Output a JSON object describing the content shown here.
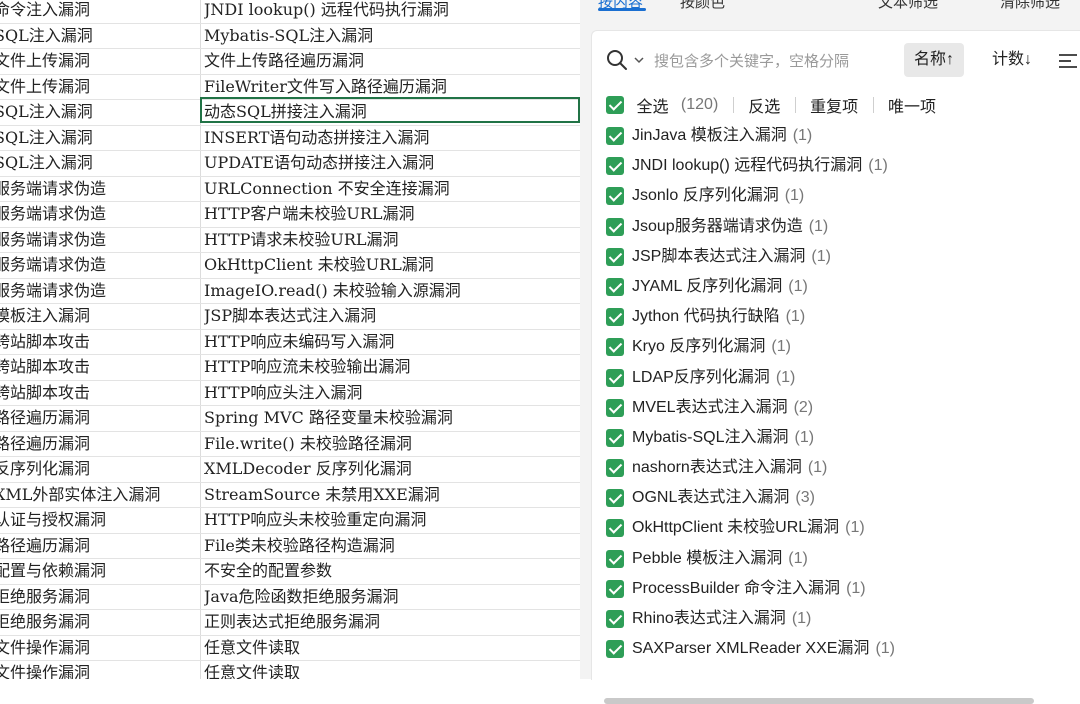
{
  "sheet": {
    "rows": [
      {
        "a": "命令注入漏洞",
        "b": "JNDI lookup() 远程代码执行漏洞"
      },
      {
        "a": "SQL注入漏洞",
        "b": "Mybatis-SQL注入漏洞"
      },
      {
        "a": "文件上传漏洞",
        "b": "文件上传路径遍历漏洞"
      },
      {
        "a": "文件上传漏洞",
        "b": "FileWriter文件写入路径遍历漏洞"
      },
      {
        "a": "SQL注入漏洞",
        "b": "动态SQL拼接注入漏洞"
      },
      {
        "a": "SQL注入漏洞",
        "b": "INSERT语句动态拼接注入漏洞"
      },
      {
        "a": "SQL注入漏洞",
        "b": "UPDATE语句动态拼接注入漏洞"
      },
      {
        "a": "服务端请求伪造",
        "b": "URLConnection 不安全连接漏洞"
      },
      {
        "a": "服务端请求伪造",
        "b": "HTTP客户端未校验URL漏洞"
      },
      {
        "a": "服务端请求伪造",
        "b": "HTTP请求未校验URL漏洞"
      },
      {
        "a": "服务端请求伪造",
        "b": "OkHttpClient 未校验URL漏洞"
      },
      {
        "a": "服务端请求伪造",
        "b": "ImageIO.read() 未校验输入源漏洞"
      },
      {
        "a": "模板注入漏洞",
        "b": "JSP脚本表达式注入漏洞"
      },
      {
        "a": "跨站脚本攻击",
        "b": "HTTP响应未编码写入漏洞"
      },
      {
        "a": "跨站脚本攻击",
        "b": "HTTP响应流未校验输出漏洞"
      },
      {
        "a": "跨站脚本攻击",
        "b": "HTTP响应头注入漏洞"
      },
      {
        "a": "路径遍历漏洞",
        "b": "Spring MVC 路径变量未校验漏洞"
      },
      {
        "a": "路径遍历漏洞",
        "b": "File.write() 未校验路径漏洞"
      },
      {
        "a": "反序列化漏洞",
        "b": "XMLDecoder 反序列化漏洞"
      },
      {
        "a": "XML外部实体注入漏洞",
        "b": "StreamSource 未禁用XXE漏洞"
      },
      {
        "a": "认证与授权漏洞",
        "b": "HTTP响应头未校验重定向漏洞"
      },
      {
        "a": "路径遍历漏洞",
        "b": "File类未校验路径构造漏洞"
      },
      {
        "a": "配置与依赖漏洞",
        "b": "不安全的配置参数"
      },
      {
        "a": "拒绝服务漏洞",
        "b": "Java危险函数拒绝服务漏洞"
      },
      {
        "a": "拒绝服务漏洞",
        "b": "正则表达式拒绝服务漏洞"
      },
      {
        "a": "文件操作漏洞",
        "b": "任意文件读取"
      },
      {
        "a": "文件操作漏洞",
        "b": "任意文件读取"
      }
    ]
  },
  "panel": {
    "tabs": [
      {
        "label": "按内容"
      },
      {
        "label": "按颜色"
      },
      {
        "label": "文本筛选"
      },
      {
        "label": "清除筛选"
      }
    ],
    "search_placeholder": "搜包含多个关键字，空格分隔",
    "sort_name_label": "名称↑",
    "sort_count_label": "计数↓",
    "select_all_label": "全选",
    "select_all_count": "(120)",
    "invert_label": "反选",
    "duplicates_label": "重复项",
    "unique_label": "唯一项",
    "items": [
      {
        "label": "JinJava 模板注入漏洞",
        "count": "(1)"
      },
      {
        "label": "JNDI lookup() 远程代码执行漏洞",
        "count": "(1)"
      },
      {
        "label": "Jsonlo 反序列化漏洞",
        "count": "(1)"
      },
      {
        "label": "Jsoup服务器端请求伪造",
        "count": "(1)"
      },
      {
        "label": "JSP脚本表达式注入漏洞",
        "count": "(1)"
      },
      {
        "label": "JYAML 反序列化漏洞",
        "count": "(1)"
      },
      {
        "label": "Jython 代码执行缺陷",
        "count": "(1)"
      },
      {
        "label": "Kryo 反序列化漏洞",
        "count": "(1)"
      },
      {
        "label": "LDAP反序列化漏洞",
        "count": "(1)"
      },
      {
        "label": "MVEL表达式注入漏洞",
        "count": "(2)"
      },
      {
        "label": "Mybatis-SQL注入漏洞",
        "count": "(1)"
      },
      {
        "label": "nashorn表达式注入漏洞",
        "count": "(1)"
      },
      {
        "label": "OGNL表达式注入漏洞",
        "count": "(3)"
      },
      {
        "label": "OkHttpClient 未校验URL漏洞",
        "count": "(1)"
      },
      {
        "label": "Pebble 模板注入漏洞",
        "count": "(1)"
      },
      {
        "label": "ProcessBuilder 命令注入漏洞",
        "count": "(1)"
      },
      {
        "label": "Rhino表达式注入漏洞",
        "count": "(1)"
      },
      {
        "label": "SAXParser XMLReader XXE漏洞",
        "count": "(1)"
      }
    ]
  }
}
